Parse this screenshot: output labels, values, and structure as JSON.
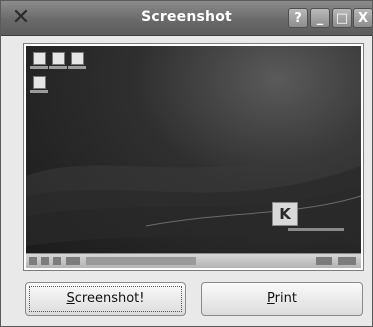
{
  "window": {
    "title": "Screenshot",
    "icon": "x-close-icon",
    "controls": {
      "help": "?",
      "minimize": "_",
      "maximize": "□",
      "close": "X"
    }
  },
  "preview": {
    "logo_text": "K"
  },
  "buttons": {
    "screenshot": {
      "mnemonic": "S",
      "rest": "creenshot!"
    },
    "print": {
      "mnemonic": "P",
      "rest": "rint"
    }
  }
}
